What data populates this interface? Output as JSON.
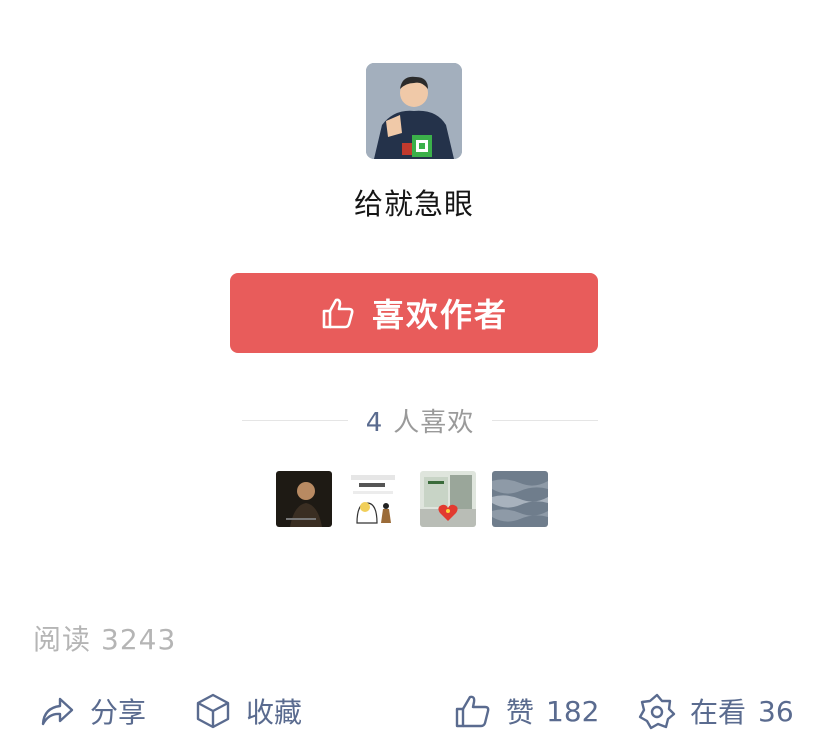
{
  "author": {
    "name": "给就急眼"
  },
  "like_button": {
    "label": "喜欢作者"
  },
  "likes": {
    "count": "4",
    "suffix": "人喜欢"
  },
  "stats": {
    "read_label": "阅读",
    "read_count": "3243"
  },
  "actions": {
    "share_label": "分享",
    "favorite_label": "收藏",
    "like_label": "赞",
    "like_count": "182",
    "looking_label": "在看",
    "looking_count": "36"
  },
  "colors": {
    "accent_red": "#e85c5b",
    "link_blue": "#5a6b8f",
    "muted_gray": "#b5b5b5"
  }
}
